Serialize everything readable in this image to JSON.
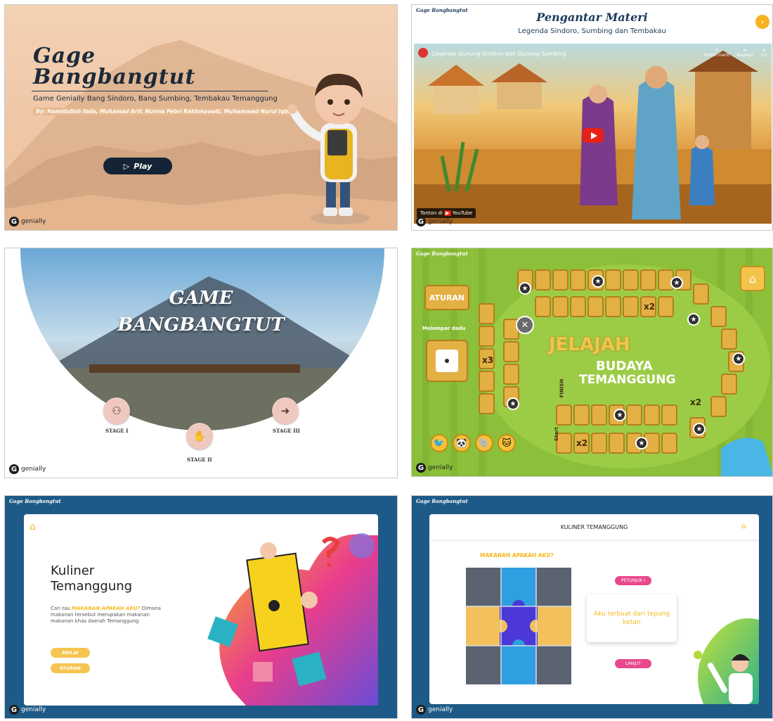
{
  "panel1": {
    "title_line1": "Gage",
    "title_line2": "Bangbangtut",
    "subtitle": "Game Genially Bang Sindoro, Bang Sumbing, Tembakau Temanggung",
    "authors": "By: Hamidulloh Ibda, Muhamad Arif, Nurma Febri Rakhmawati, Muhammad Nurul Iqbal",
    "play_label": "Play",
    "play_icon": "▷",
    "brand": "genially"
  },
  "panel2": {
    "title": "Pengantar Materi",
    "subtitle": "Legenda Sindoro, Sumbing dan Tembakau",
    "video_title": "Legenda Gunung Sindoro dan Gunung Sumbing",
    "video_actions": [
      "Tonton nanti",
      "Bagikan",
      "1/1"
    ],
    "watch_on": "Tonton di",
    "youtube": "YouTube",
    "next_icon": "›",
    "logo": "Gage Bangbangtut",
    "brand": "genially"
  },
  "panel3": {
    "title_line1": "GAME",
    "title_line2": "BANGBANGTUT",
    "stages": [
      "STAGE I",
      "STAGE II",
      "STAGE III"
    ],
    "stage_icons": [
      "gamepad-icon",
      "hand-icon",
      "arrow-icon"
    ],
    "brand": "genially"
  },
  "panel4": {
    "logo": "Gage Bangbangtut",
    "rules_label": "ATURAN",
    "dice_label": "Melempar dadu",
    "title_line1": "JELAJAH",
    "title_line2": "BUDAYA",
    "title_line3": "TEMANGGUNG",
    "x2": "x2",
    "x3": "x3",
    "finish": "FINISH",
    "start": "Start",
    "brand": "genially"
  },
  "panel5": {
    "logo": "Gage Bangbangtut",
    "title_line1": "Kuliner",
    "title_line2": "Temanggung",
    "desc_prefix": "Cari tau",
    "desc_highlight": "MAKANAN APAKAH AKU?",
    "desc_body": "Dimana makanan tersebut merupakan makanan makanan khas daerah Temanggung",
    "start_label": "MULAI",
    "rules_label": "ATURAN",
    "brand": "genially"
  },
  "panel6": {
    "logo": "Gage Bangbangtut",
    "header": "KULINER TEMANGGUNG",
    "question": "MAKANAN APAKAH AKU?",
    "hint_label": "PETUNJUK I",
    "clue": "Aku terbuat dari tepung ketan",
    "next_label": "LANJUT",
    "brand": "genially"
  },
  "colors": {
    "navy": "#1e5a87",
    "gold": "#f6b91d",
    "pink": "#e8498c",
    "board_green": "#8cbf3a",
    "tile": "#e3b043"
  }
}
